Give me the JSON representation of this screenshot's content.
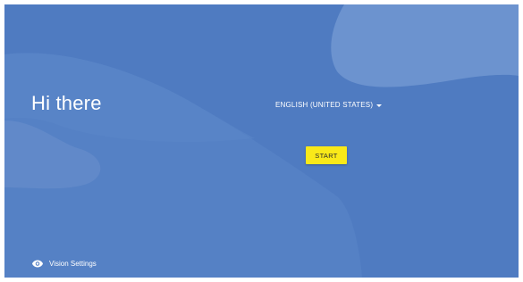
{
  "welcome": {
    "greeting": "Hi there",
    "language": {
      "selected": "ENGLISH (UNITED STATES)",
      "icon": "dropdown-arrow-icon"
    },
    "start_label": "START",
    "vision_settings": {
      "label": "Vision Settings",
      "icon": "eye-icon"
    }
  },
  "colors": {
    "background": "#4f7bc1",
    "start_button": "#f9e919",
    "text": "#ffffff"
  }
}
